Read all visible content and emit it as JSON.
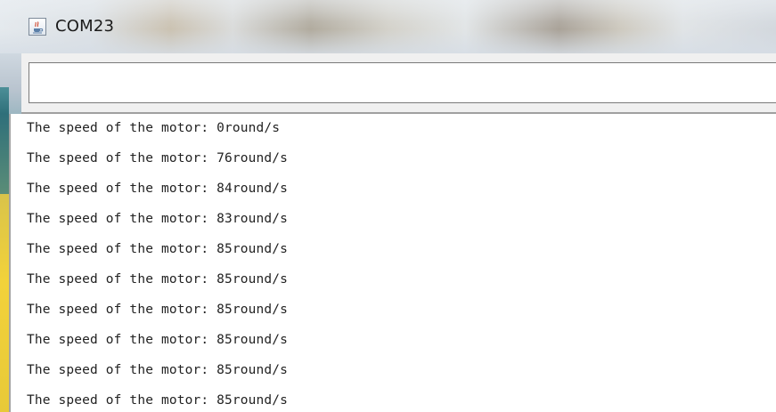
{
  "window": {
    "title": "COM23",
    "icon": "java-cup-icon"
  },
  "send_field": {
    "value": "",
    "placeholder": ""
  },
  "serial_output": [
    "The speed of the motor: 0round/s",
    "The speed of the motor: 76round/s",
    "The speed of the motor: 84round/s",
    "The speed of the motor: 83round/s",
    "The speed of the motor: 85round/s",
    "The speed of the motor: 85round/s",
    "The speed of the motor: 85round/s",
    "The speed of the motor: 85round/s",
    "The speed of the motor: 85round/s",
    "The speed of the motor: 85round/s"
  ]
}
